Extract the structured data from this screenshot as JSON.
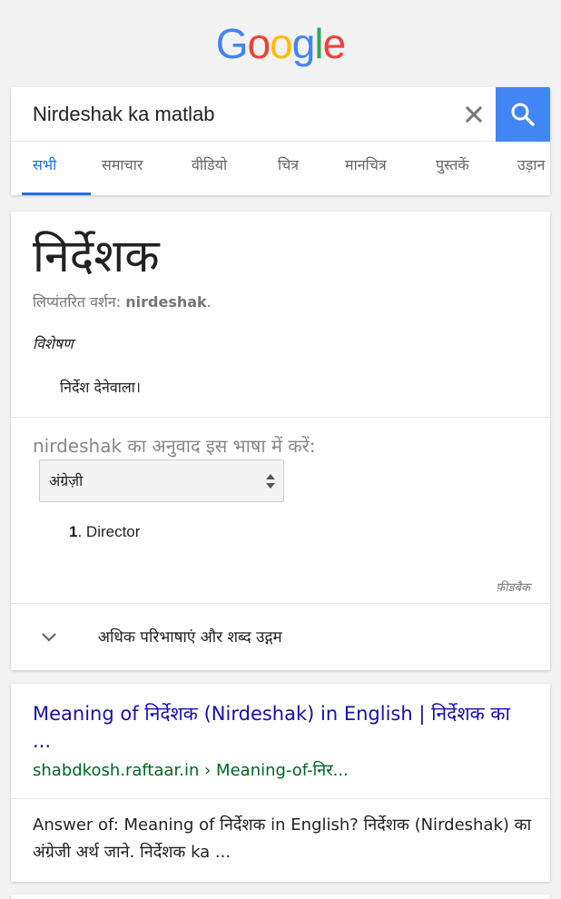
{
  "logo": {
    "letters": [
      "G",
      "o",
      "o",
      "g",
      "l",
      "e"
    ],
    "colors": [
      "#4285f4",
      "#ea4335",
      "#fbbc05",
      "#4285f4",
      "#34a853",
      "#ea4335"
    ]
  },
  "search": {
    "query": "Nirdeshak ka matlab",
    "clear_icon": "close-icon",
    "search_icon": "search-icon",
    "accent": "#4285f4"
  },
  "tabs": [
    {
      "label": "सभी",
      "active": true
    },
    {
      "label": "समाचार"
    },
    {
      "label": "वीडियो"
    },
    {
      "label": "चित्र"
    },
    {
      "label": "मानचित्र"
    },
    {
      "label": "पुस्तकें"
    },
    {
      "label": "उड़ान"
    }
  ],
  "dictionary": {
    "word": "निर्देशक",
    "translit_prefix": "लिप्यंतरित वर्शन: ",
    "translit_value": "nirdeshak",
    "translit_suffix": ".",
    "part_of_speech": "विशेषण",
    "definition": "निर्देश देनेवाला।",
    "translate_label": "nirdeshak का अनुवाद इस भाषा में करें:",
    "language_selected": "अंग्रेज़ी",
    "translations": [
      {
        "num": "1",
        "text": ". Director"
      }
    ],
    "feedback": "फ़ीडबैक",
    "more_label": "अधिक परिभाषाएं और शब्द उद्गम"
  },
  "result": {
    "title": "Meaning of निर्देशक (Nirdeshak) in English | निर्देशक का ...",
    "url": "shabdkosh.raftaar.in › Meaning-of-निर...",
    "snippet": "Answer of: Meaning of निर्देशक in English? निर्देशक (Nirdeshak) का अंग्रेजी अर्थ जाने. निर्देशक ka ..."
  }
}
